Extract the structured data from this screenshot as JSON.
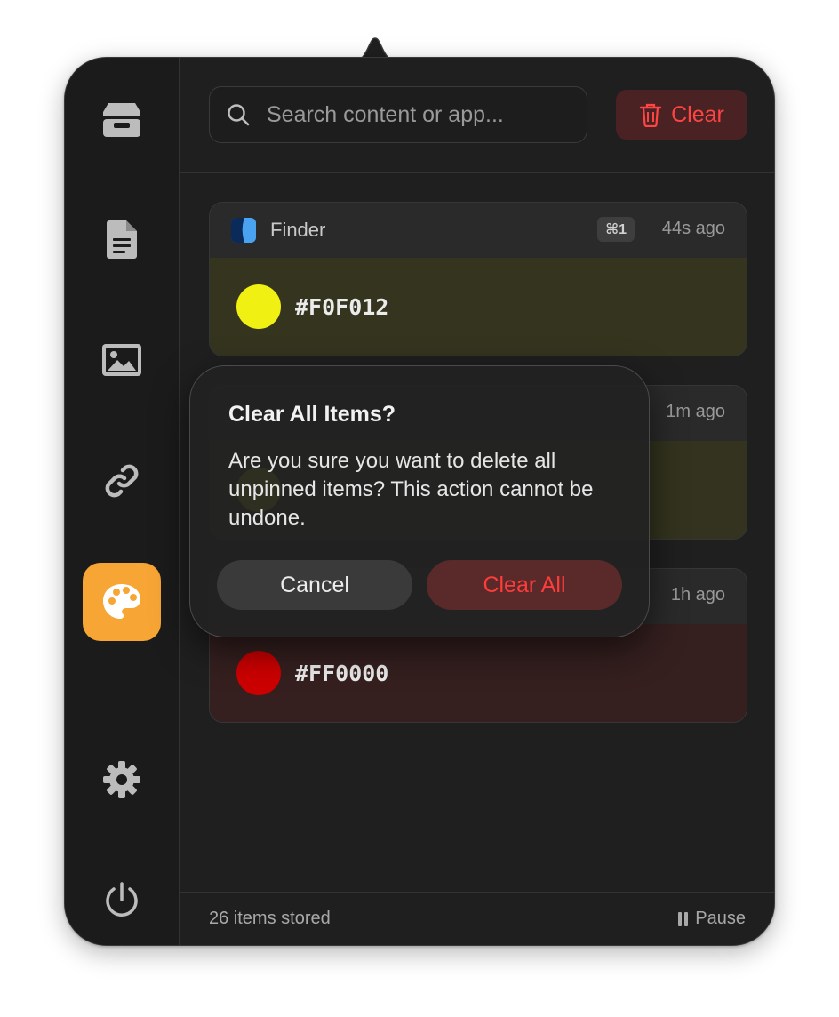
{
  "search": {
    "placeholder": "Search content or app..."
  },
  "toolbar": {
    "clear_label": "Clear"
  },
  "sidebar": {
    "items": [
      {
        "icon": "tray-icon"
      },
      {
        "icon": "document-icon"
      },
      {
        "icon": "image-icon"
      },
      {
        "icon": "link-icon"
      },
      {
        "icon": "palette-icon",
        "active": true
      },
      {
        "icon": "gear-icon"
      },
      {
        "icon": "power-icon"
      }
    ],
    "active_color": "#f7a535"
  },
  "cards": [
    {
      "app": "Finder",
      "shortcut": "⌘1",
      "time": "44s ago",
      "hex": "#F0F012",
      "swatch": "#F0F012",
      "tint": "#34341f"
    },
    {
      "time": "1m ago",
      "hex": "",
      "swatch": "#F0F012",
      "tint": "#33331f"
    },
    {
      "time": "1h ago",
      "hex": "#FF0000",
      "swatch": "#CC0000",
      "tint": "#351f1f"
    }
  ],
  "footer": {
    "count": "26 items stored",
    "pause_label": "Pause"
  },
  "dialog": {
    "title": "Clear All Items?",
    "message": "Are you sure you want to delete all unpinned items? This action cannot be undone.",
    "cancel_label": "Cancel",
    "confirm_label": "Clear All"
  },
  "colors": {
    "accent": "#f7a535",
    "danger": "#ff4444"
  }
}
